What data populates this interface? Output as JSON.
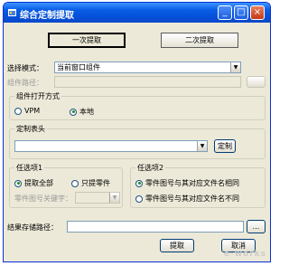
{
  "window": {
    "title": "综合定制提取",
    "minimize_symbol": "_",
    "maximize_symbol": "□",
    "close_symbol": "×"
  },
  "tabs": [
    {
      "label": "一次提取",
      "active": true
    },
    {
      "label": "二次提取",
      "active": false
    }
  ],
  "select_mode": {
    "label": "选择模式：",
    "value": "当前窗口组件"
  },
  "component_path": {
    "label": "组件路径：",
    "value": "",
    "browse_label": ""
  },
  "open_method": {
    "title": "组件打开方式",
    "options": [
      {
        "label": "VPM",
        "checked": false
      },
      {
        "label": "本地",
        "checked": true
      }
    ]
  },
  "custom_header": {
    "title": "定制表头",
    "value": "",
    "button_label": "定制"
  },
  "option1": {
    "title": "任选项1",
    "options": [
      {
        "label": "提取全部",
        "checked": true
      },
      {
        "label": "只提零件",
        "checked": false
      }
    ],
    "keyword_label": "零件图号关键字：",
    "keyword_value": ""
  },
  "option2": {
    "title": "任选项2",
    "options": [
      {
        "label": "零件图号与其对应文件名相同",
        "checked": true
      },
      {
        "label": "零件图号与其对应文件名不同",
        "checked": false
      }
    ]
  },
  "result_path": {
    "label": "结果存储路径：",
    "value": "",
    "browse_label": "..."
  },
  "actions": {
    "extract_label": "提取",
    "cancel_label": "取消"
  },
  "watermark": "e-works",
  "colors": {
    "titlebar": "#0a5ee6",
    "window_bg": "#ece9d8",
    "radio_dot": "#1f8a1f"
  }
}
